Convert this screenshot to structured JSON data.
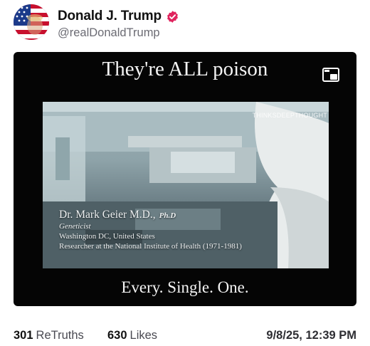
{
  "post": {
    "author": {
      "display_name": "Donald J. Trump",
      "handle": "@realDonaldTrump",
      "verified_icon": "verified-badge-icon",
      "verified_color": "#e0245e"
    },
    "media": {
      "caption_top": "They're ALL poison",
      "caption_bottom": "Every. Single. One.",
      "watermark": "THINKSDEEPTHOUGHT",
      "pip_icon": "picture-in-picture-icon",
      "lower_third": {
        "name": "Dr. Mark Geier M.D.,",
        "credential": "Ph.D",
        "line1": "Geneticist",
        "line2": "Washington DC, United States",
        "line3": "Researcher at the National Institute of Health (1971-1981)"
      }
    },
    "stats": {
      "retruths_count": "301",
      "retruths_label": "ReTruths",
      "likes_count": "630",
      "likes_label": "Likes"
    },
    "timestamp": "9/8/25, 12:39 PM"
  }
}
